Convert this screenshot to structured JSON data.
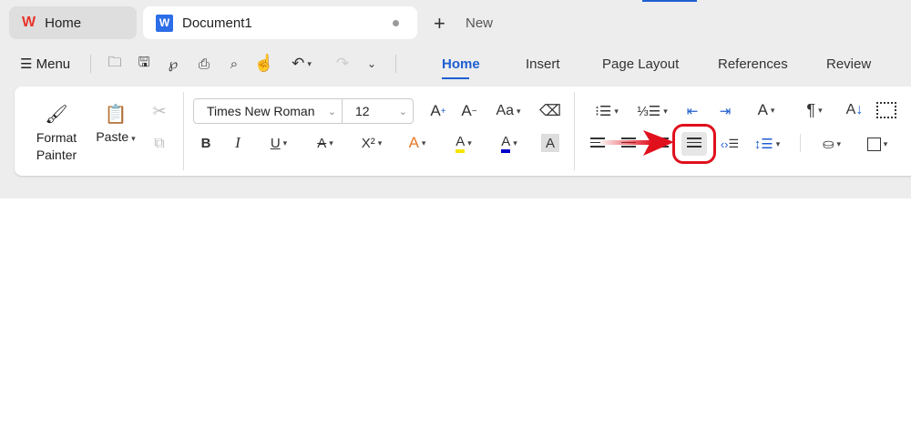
{
  "tabs": [
    {
      "label": "Home"
    },
    {
      "label": "Document1"
    }
  ],
  "new_tab": "New",
  "menu_label": "Menu",
  "ribbon_tabs": [
    "Home",
    "Insert",
    "Page Layout",
    "References",
    "Review"
  ],
  "clipboard": {
    "format_painter_1": "Format",
    "format_painter_2": "Painter",
    "paste": "Paste"
  },
  "font": {
    "name": "Times New Roman",
    "size": "12"
  },
  "glyphs": {
    "bold": "B",
    "italic": "I",
    "underline": "U",
    "strike": "A",
    "superscript": "X²",
    "grow": "A",
    "shrink": "A",
    "case": "Aa",
    "text_effect": "A",
    "highlight": "A",
    "font_color": "A",
    "shading": "A",
    "pilcrow": "¶"
  },
  "colors": {
    "accent": "#1f5fd1",
    "annotation": "#e0101c",
    "font_color": "#0000cc",
    "highlight": "#f5e400"
  }
}
